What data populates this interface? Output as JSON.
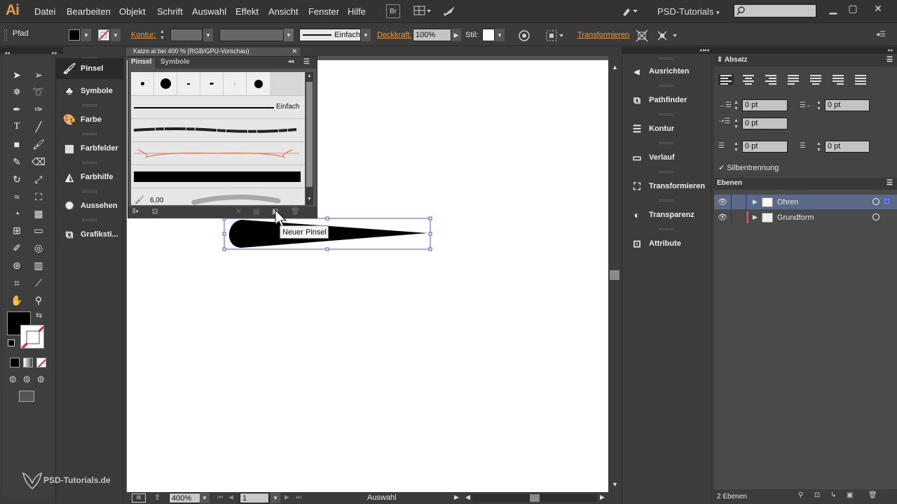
{
  "app": {
    "logo": "Ai",
    "workspace": "PSD-Tutorials"
  },
  "menu": [
    "Datei",
    "Bearbeiten",
    "Objekt",
    "Schrift",
    "Auswahl",
    "Effekt",
    "Ansicht",
    "Fenster",
    "Hilfe"
  ],
  "menubar_icons": {
    "bridge": "Br"
  },
  "control": {
    "selection_label": "Pfad",
    "stroke_label": "Kontur:",
    "stroke_style": "Einfach",
    "opacity_label": "Deckkraft:",
    "opacity_value": "100%",
    "style_label": "Stil:",
    "transform_label": "Transformieren"
  },
  "document": {
    "tab_title": "Katze.ai bei 400 % (RGB/GPU-Vorschau)"
  },
  "tools_dock": [
    {
      "label": "Pinsel",
      "icon": "brush-icon"
    },
    {
      "label": "Symbole",
      "icon": "club-icon"
    },
    {
      "label": "Farbe",
      "icon": "palette-icon"
    },
    {
      "label": "Farbfelder",
      "icon": "grid-icon"
    },
    {
      "label": "Farbhilfe",
      "icon": "color-guide-icon"
    },
    {
      "label": "Aussehen",
      "icon": "appearance-icon"
    },
    {
      "label": "Grafiksti...",
      "icon": "graphic-style-icon"
    }
  ],
  "brush_panel": {
    "tabs": [
      "Pinsel",
      "Symbole"
    ],
    "stroke_name": "Einfach",
    "size_value": "6,00",
    "tooltip": "Neuer Pinsel"
  },
  "right_dock": [
    {
      "label": "Ausrichten",
      "icon": "align-icon"
    },
    {
      "label": "Pathfinder",
      "icon": "pathfinder-icon"
    },
    {
      "label": "Kontur",
      "icon": "stroke-icon"
    },
    {
      "label": "Verlauf",
      "icon": "gradient-icon"
    },
    {
      "label": "Transformieren",
      "icon": "transform-icon"
    },
    {
      "label": "Transparenz",
      "icon": "transparency-icon"
    },
    {
      "label": "Attribute",
      "icon": "attributes-icon"
    }
  ],
  "absatz": {
    "title": "Absatz",
    "left_indent": "0 pt",
    "right_indent": "0 pt",
    "first_indent": "0 pt",
    "space_before": "0 pt",
    "space_after": "0 pt",
    "hyphenation": "Silbentrennung",
    "hyphenation_checked": true
  },
  "ebenen": {
    "title": "Ebenen",
    "layers": [
      {
        "name": "Ohren",
        "color": "#4f5bd5",
        "selected": true
      },
      {
        "name": "Grundform",
        "color": "#e0475a",
        "selected": false
      }
    ],
    "count_label": "2 Ebenen"
  },
  "status": {
    "zoom": "400%",
    "artboard": "1",
    "tool": "Auswahl"
  },
  "watermark": "PSD-Tutorials.de"
}
